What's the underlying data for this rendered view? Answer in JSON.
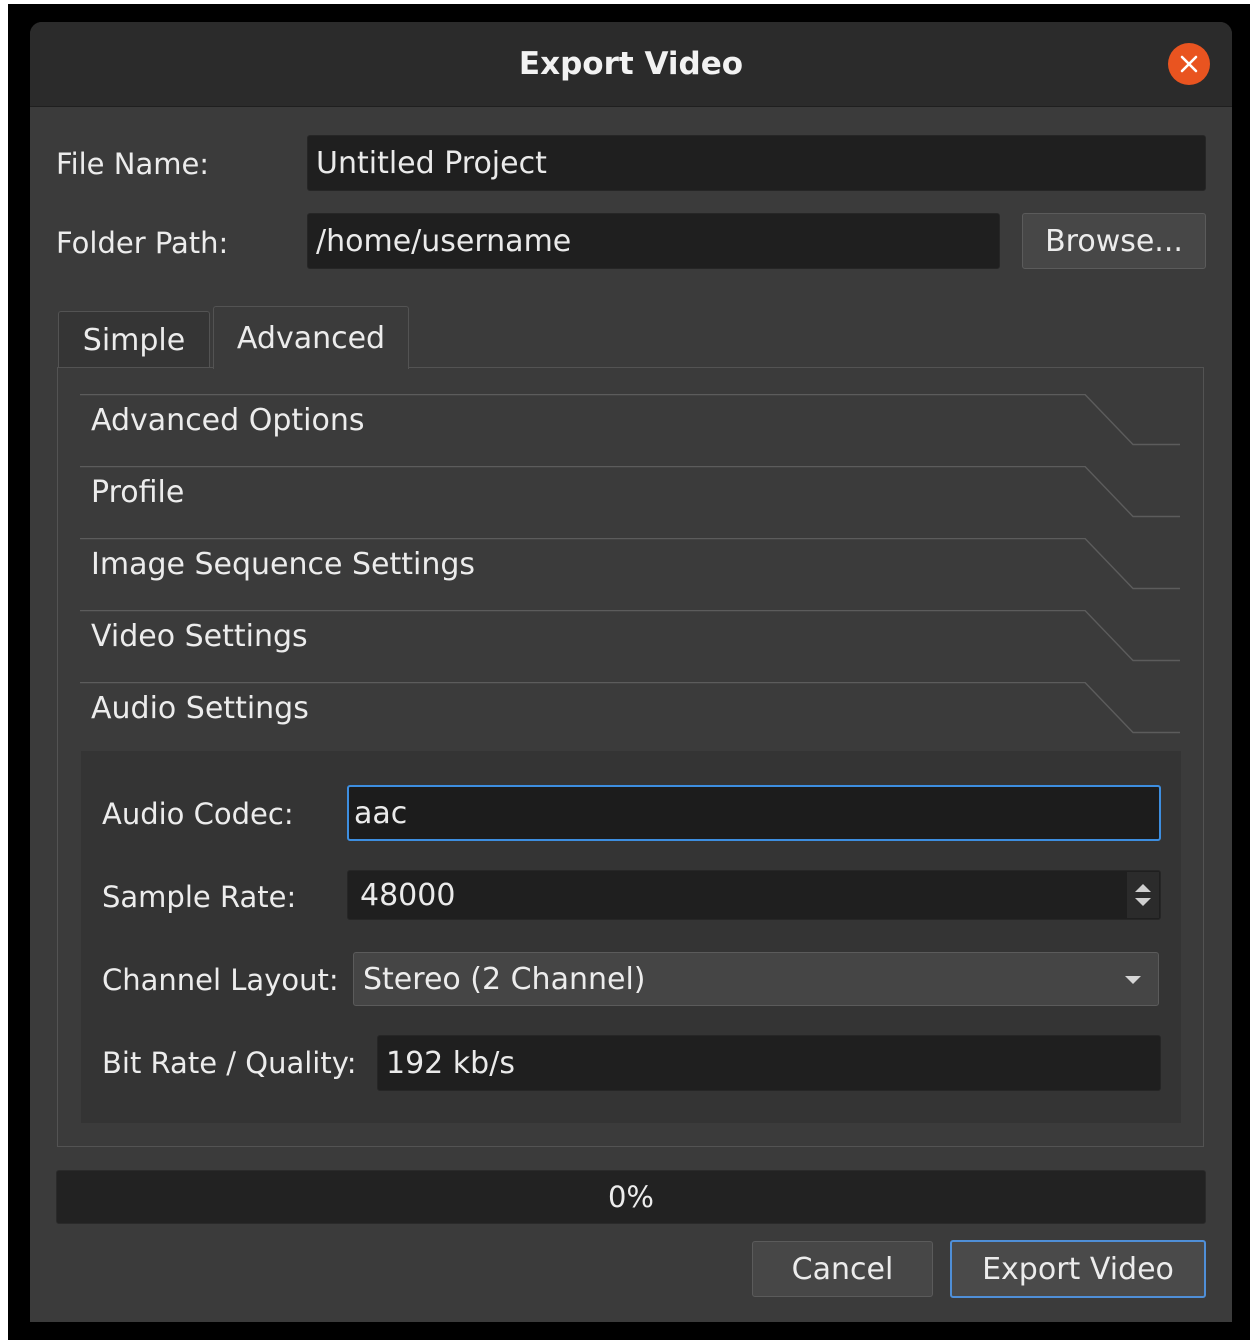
{
  "window": {
    "title": "Export Video"
  },
  "file_name": {
    "label": "File Name:",
    "value": "Untitled Project"
  },
  "folder_path": {
    "label": "Folder Path:",
    "value": "/home/username",
    "browse_label": "Browse..."
  },
  "tabs": [
    {
      "label": "Simple",
      "active": false
    },
    {
      "label": "Advanced",
      "active": true
    }
  ],
  "sections": [
    {
      "label": "Advanced Options"
    },
    {
      "label": "Profile"
    },
    {
      "label": "Image Sequence Settings"
    },
    {
      "label": "Video Settings"
    },
    {
      "label": "Audio Settings",
      "expanded": true
    }
  ],
  "audio_settings": {
    "codec_label": "Audio Codec:",
    "codec_value": "aac",
    "sample_rate_label": "Sample Rate:",
    "sample_rate_value": "48000",
    "channel_layout_label": "Channel Layout:",
    "channel_layout_value": "Stereo (2 Channel)",
    "bit_rate_label": "Bit Rate / Quality:",
    "bit_rate_value": "192 kb/s"
  },
  "progress": {
    "text": "0%",
    "fraction": 0
  },
  "buttons": {
    "cancel_label": "Cancel",
    "export_label": "Export Video"
  },
  "colors": {
    "accent": "#3d8ee0",
    "close_button": "#e95420",
    "window_bg": "#3b3b3b",
    "field_bg": "#1f1f1f"
  },
  "icons": {
    "close": "close-icon",
    "spin": "spin-arrows-icon",
    "dropdown": "chevron-down-icon"
  }
}
